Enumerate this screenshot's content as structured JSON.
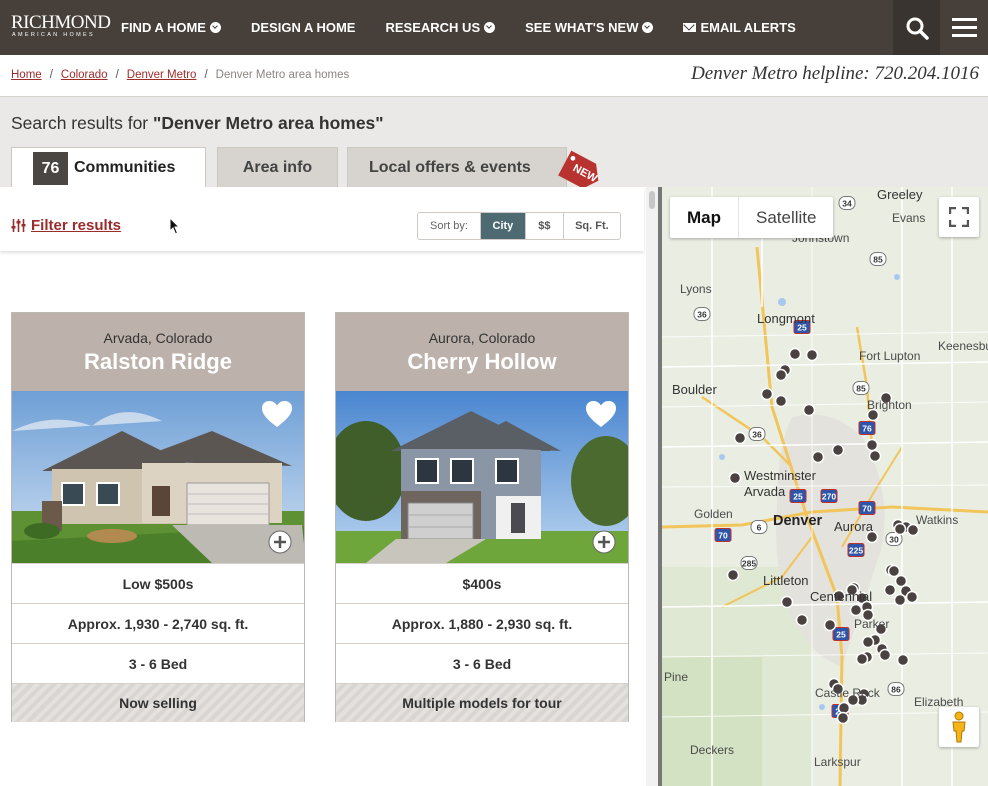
{
  "nav": {
    "logo_main": "RICHMOND",
    "logo_sub": "AMERICAN HOMES",
    "items": [
      {
        "label": "FIND A HOME",
        "has_dropdown": true
      },
      {
        "label": "DESIGN A HOME",
        "has_dropdown": false
      },
      {
        "label": "RESEARCH US",
        "has_dropdown": true
      },
      {
        "label": "SEE WHAT'S NEW",
        "has_dropdown": true
      }
    ],
    "email_alerts": "EMAIL ALERTS",
    "search_icon": "search-icon",
    "menu_icon": "hamburger-menu-icon"
  },
  "breadcrumb": {
    "items": [
      "Home",
      "Colorado",
      "Denver Metro"
    ],
    "current": "Denver Metro area homes"
  },
  "helpline": {
    "label": "Denver Metro helpline:",
    "number": "720.204.1016"
  },
  "search": {
    "prefix": "Search results for",
    "query": "\"Denver Metro area homes\""
  },
  "tabs": {
    "communities_count": "76",
    "communities_label": "Communities",
    "area_info": "Area info",
    "local_offers": "Local offers & events",
    "new_badge": "NEW"
  },
  "filter": {
    "label": "Filter results",
    "sort_label": "Sort by:",
    "sort_options": [
      "City",
      "$$",
      "Sq. Ft."
    ],
    "sort_active": "City"
  },
  "cards": [
    {
      "location": "Arvada, Colorado",
      "name": "Ralston Ridge",
      "price": "Low $500s",
      "sqft": "Approx. 1,930 - 2,740 sq. ft.",
      "beds": "3 - 6 Bed",
      "status": "Now selling"
    },
    {
      "location": "Aurora, Colorado",
      "name": "Cherry Hollow",
      "price": "$400s",
      "sqft": "Approx. 1,880 - 2,930 sq. ft.",
      "beds": "3 - 6 Bed",
      "status": "Multiple models for tour"
    }
  ],
  "map": {
    "type_map": "Map",
    "type_satellite": "Satellite",
    "active_type": "Map",
    "place_labels": [
      "Greeley",
      "Evans",
      "Johnstown",
      "Lyons",
      "Longmont",
      "Fort Lupton",
      "Keenesbu",
      "Boulder",
      "Brighton",
      "Westminster",
      "Arvada",
      "Golden",
      "Denver",
      "Aurora",
      "Watkins",
      "Littleton",
      "Centennial",
      "Parker",
      "Pine",
      "Castle Rock",
      "Elizabeth",
      "Deckers",
      "Larkspur"
    ],
    "highway_shields": [
      "34",
      "85",
      "36",
      "25",
      "85",
      "36",
      "76",
      "25",
      "270",
      "70",
      "6",
      "70",
      "225",
      "30",
      "285",
      "25",
      "86",
      "25"
    ],
    "fullscreen_icon": "fullscreen-icon",
    "pegman_icon": "street-view-pegman-icon"
  },
  "colors": {
    "nav_bg": "#463f3a",
    "link": "#9b2c2c",
    "card_head": "#bcb2ab",
    "sort_active": "#4d6a72",
    "pin": "#4a4240"
  }
}
